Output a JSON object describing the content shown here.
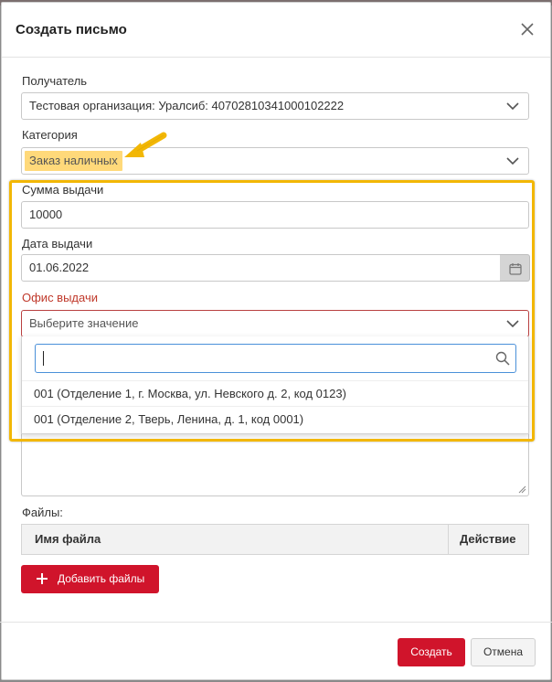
{
  "dialog": {
    "title": "Создать письмо"
  },
  "recipient": {
    "label": "Получатель",
    "value": "Тестовая организация: Уралсиб: 40702810341000102222"
  },
  "category": {
    "label": "Категория",
    "value": "Заказ наличных"
  },
  "amount": {
    "label": "Сумма выдачи",
    "value": "10000"
  },
  "date": {
    "label": "Дата выдачи",
    "value": "01.06.2022"
  },
  "office": {
    "label": "Офис выдачи",
    "placeholder": "Выберите значение",
    "search_value": "",
    "options": [
      "001 (Отделение 1, г. Москва, ул. Невского д. 2, код 0123)",
      "001 (Отделение 2, Тверь, Ленина, д. 1, код 0001)"
    ]
  },
  "files": {
    "label": "Файлы:",
    "columns": [
      "Имя файла",
      "Действие"
    ],
    "add_label": "Добавить файлы"
  },
  "footer": {
    "create_label": "Создать",
    "cancel_label": "Отмена"
  },
  "colors": {
    "primary": "#d0142b",
    "highlight": "#ffd97a",
    "annotation": "#f2b705",
    "error": "#c0392b"
  },
  "icons": {
    "close": "close-icon",
    "chevron": "chevron-down-icon",
    "calendar": "calendar-icon",
    "search": "search-icon",
    "plus": "plus-icon",
    "resize": "resize-grip-icon",
    "arrow": "annotation-arrow-icon"
  }
}
